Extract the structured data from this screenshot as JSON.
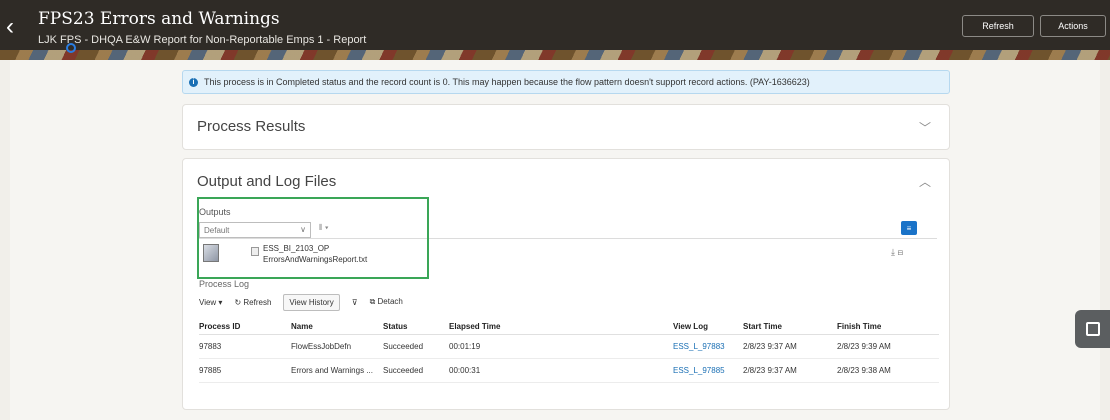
{
  "header": {
    "title": "FPS23 Errors and Warnings",
    "subtitle": "LJK FPS - DHQA E&W Report for Non-Reportable Emps 1 - Report",
    "refresh_label": "Refresh",
    "actions_label": "Actions"
  },
  "banner": {
    "text": "This process is in Completed status and the record count is 0. This may happen because the flow pattern doesn't support record actions. (PAY-1636623)"
  },
  "process_results": {
    "title": "Process Results"
  },
  "output_log": {
    "title": "Output and Log Files",
    "outputs_label": "Outputs",
    "select_value": "Default",
    "file_name": "ESS_BI_2103_OP",
    "file_report": "ErrorsAndWarningsReport.txt"
  },
  "process_log": {
    "label": "Process Log",
    "view_label": "View",
    "refresh_label": "Refresh",
    "view_history_label": "View History",
    "detach_label": "Detach",
    "columns": [
      "Process ID",
      "Name",
      "Status",
      "Elapsed Time",
      "View Log",
      "Start Time",
      "Finish Time"
    ],
    "rows": [
      [
        "97883",
        "FlowEssJobDefn",
        "Succeeded",
        "00:01:19",
        "ESS_L_97883",
        "2/8/23 9:37 AM",
        "2/8/23 9:39 AM"
      ],
      [
        "97885",
        "Errors and Warnings ...",
        "Succeeded",
        "00:00:31",
        "ESS_L_97885",
        "2/8/23 9:37 AM",
        "2/8/23 9:38 AM"
      ]
    ]
  },
  "icons": {
    "back": "chevron-left-icon",
    "info": "info-icon",
    "collapse": "chevron-down-icon",
    "expand": "chevron-up-icon"
  },
  "colors": {
    "header_bg": "#2f2b26",
    "link": "#1a6fb4",
    "highlight_box": "#3aa657",
    "banner_bg": "#e2f1fb"
  }
}
